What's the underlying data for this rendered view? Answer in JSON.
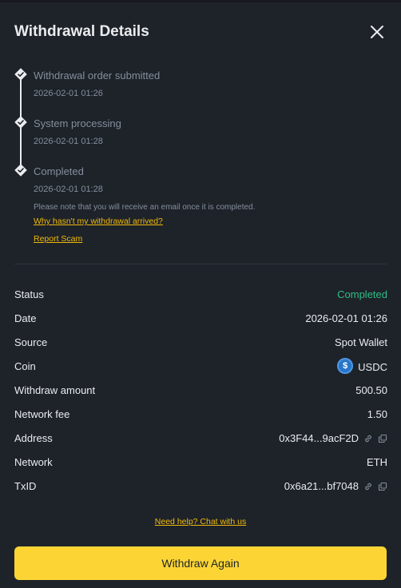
{
  "dialog": {
    "title": "Withdrawal Details"
  },
  "timeline": {
    "steps": [
      {
        "label": "Withdrawal order submitted",
        "time": "2026-02-01 01:26"
      },
      {
        "label": "System processing",
        "time": "2026-02-01 01:28"
      },
      {
        "label": "Completed",
        "time": "2026-02-01 01:28"
      }
    ],
    "note": "Please note that you will receive an email once it is completed.",
    "why_link": "Why hasn't my withdrawal arrived?",
    "report_link": "Report Scam"
  },
  "details": {
    "status": {
      "label": "Status",
      "value": "Completed"
    },
    "date": {
      "label": "Date",
      "value": "2026-02-01 01:26"
    },
    "source": {
      "label": "Source",
      "value": "Spot Wallet"
    },
    "coin": {
      "label": "Coin",
      "value": "USDC",
      "icon": "usdc-icon",
      "icon_glyph": "$"
    },
    "amount": {
      "label": "Withdraw amount",
      "value": "500.50"
    },
    "fee": {
      "label": "Network fee",
      "value": "1.50"
    },
    "address": {
      "label": "Address",
      "value": "0x3F44...9acF2D"
    },
    "network": {
      "label": "Network",
      "value": "ETH"
    },
    "txid": {
      "label": "TxID",
      "value": "0x6a21...bf7048"
    }
  },
  "footer": {
    "help_link": "Need help? Chat with us",
    "button_label": "Withdraw Again"
  },
  "colors": {
    "background": "#1e2329",
    "accent": "#fcd535",
    "link": "#f0b90b",
    "success": "#2ebd85",
    "muted": "#848e9c"
  }
}
